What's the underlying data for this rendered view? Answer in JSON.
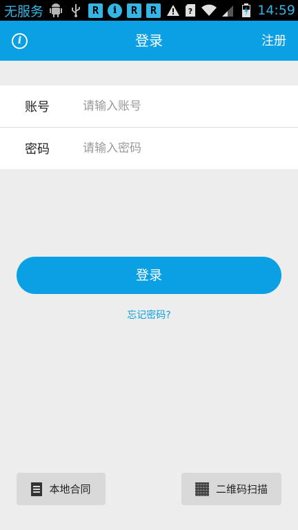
{
  "status_bar": {
    "carrier": "无服务",
    "time": "14:59",
    "icons": [
      "android-debug-icon",
      "usb-icon",
      "r-app-icon",
      "info-notification-icon",
      "r-app-icon",
      "r-app-icon",
      "warning-icon",
      "sim-unknown-icon",
      "wifi-icon",
      "signal-icon",
      "battery-charging-icon"
    ]
  },
  "app_bar": {
    "title": "登录",
    "register_label": "注册",
    "info_icon": "info-icon"
  },
  "form": {
    "account_label": "账号",
    "account_placeholder": "请输入账号",
    "account_value": "",
    "password_label": "密码",
    "password_placeholder": "请输入密码",
    "password_value": ""
  },
  "login_button_label": "登录",
  "forgot_password_label": "忘记密码?",
  "bottom": {
    "local_contract_label": "本地合同",
    "local_contract_icon": "document-icon",
    "qr_scan_label": "二维码扫描",
    "qr_scan_icon": "qr-code-icon"
  },
  "colors": {
    "accent": "#0aa0e3",
    "background": "#ededed",
    "status_accent": "#33b5e5"
  }
}
